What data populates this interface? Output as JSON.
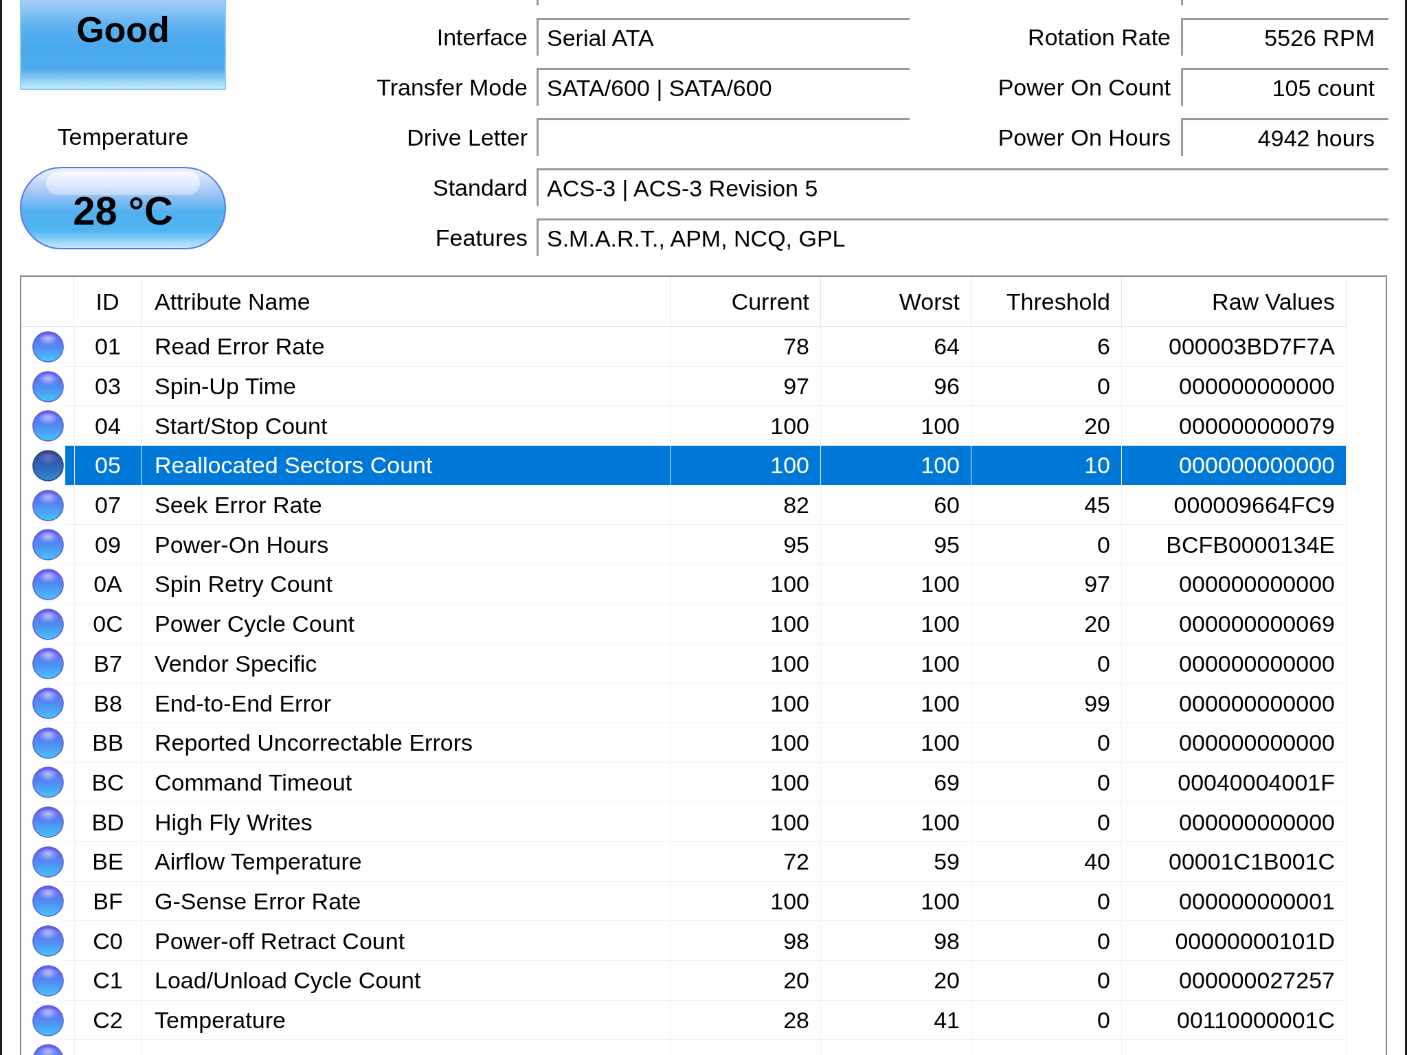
{
  "health": {
    "status": "Good"
  },
  "temperature": {
    "label": "Temperature",
    "value": "28 °C"
  },
  "drive_info": [
    {
      "kind": "paired",
      "label": "Interface",
      "value": "Serial ATA",
      "side_label": "Rotation Rate",
      "side_value": "5526 RPM"
    },
    {
      "kind": "paired",
      "label": "Transfer Mode",
      "value": "SATA/600 | SATA/600",
      "side_label": "Power On Count",
      "side_value": "105 count"
    },
    {
      "kind": "paired",
      "label": "Drive Letter",
      "side_label": "Power On Hours",
      "side_value": "4942 hours"
    },
    {
      "kind": "wide",
      "label": "Standard",
      "value": "ACS-3 | ACS-3 Revision 5"
    },
    {
      "kind": "wide",
      "label": "Features",
      "value": "S.M.A.R.T., APM, NCQ, GPL"
    }
  ],
  "smart_table": {
    "columns": [
      "ID",
      "Attribute Name",
      "Current",
      "Worst",
      "Threshold",
      "Raw Values"
    ],
    "rows": [
      {
        "id": "01",
        "name": "Read Error Rate",
        "current": "78",
        "worst": "64",
        "threshold": "6",
        "raw": "000003BD7F7A",
        "selected": false
      },
      {
        "id": "03",
        "name": "Spin-Up Time",
        "current": "97",
        "worst": "96",
        "threshold": "0",
        "raw": "000000000000",
        "selected": false
      },
      {
        "id": "04",
        "name": "Start/Stop Count",
        "current": "100",
        "worst": "100",
        "threshold": "20",
        "raw": "000000000079",
        "selected": false
      },
      {
        "id": "05",
        "name": "Reallocated Sectors Count",
        "current": "100",
        "worst": "100",
        "threshold": "10",
        "raw": "000000000000",
        "selected": true
      },
      {
        "id": "07",
        "name": "Seek Error Rate",
        "current": "82",
        "worst": "60",
        "threshold": "45",
        "raw": "000009664FC9",
        "selected": false
      },
      {
        "id": "09",
        "name": "Power-On Hours",
        "current": "95",
        "worst": "95",
        "threshold": "0",
        "raw": "BCFB0000134E",
        "selected": false
      },
      {
        "id": "0A",
        "name": "Spin Retry Count",
        "current": "100",
        "worst": "100",
        "threshold": "97",
        "raw": "000000000000",
        "selected": false
      },
      {
        "id": "0C",
        "name": "Power Cycle Count",
        "current": "100",
        "worst": "100",
        "threshold": "20",
        "raw": "000000000069",
        "selected": false
      },
      {
        "id": "B7",
        "name": "Vendor Specific",
        "current": "100",
        "worst": "100",
        "threshold": "0",
        "raw": "000000000000",
        "selected": false
      },
      {
        "id": "B8",
        "name": "End-to-End Error",
        "current": "100",
        "worst": "100",
        "threshold": "99",
        "raw": "000000000000",
        "selected": false
      },
      {
        "id": "BB",
        "name": "Reported Uncorrectable Errors",
        "current": "100",
        "worst": "100",
        "threshold": "0",
        "raw": "000000000000",
        "selected": false
      },
      {
        "id": "BC",
        "name": "Command Timeout",
        "current": "100",
        "worst": "69",
        "threshold": "0",
        "raw": "00040004001F",
        "selected": false
      },
      {
        "id": "BD",
        "name": "High Fly Writes",
        "current": "100",
        "worst": "100",
        "threshold": "0",
        "raw": "000000000000",
        "selected": false
      },
      {
        "id": "BE",
        "name": "Airflow Temperature",
        "current": "72",
        "worst": "59",
        "threshold": "40",
        "raw": "00001C1B001C",
        "selected": false
      },
      {
        "id": "BF",
        "name": "G-Sense Error Rate",
        "current": "100",
        "worst": "100",
        "threshold": "0",
        "raw": "000000000001",
        "selected": false
      },
      {
        "id": "C0",
        "name": "Power-off Retract Count",
        "current": "98",
        "worst": "98",
        "threshold": "0",
        "raw": "00000000101D",
        "selected": false
      },
      {
        "id": "C1",
        "name": "Load/Unload Cycle Count",
        "current": "20",
        "worst": "20",
        "threshold": "0",
        "raw": "000000027257",
        "selected": false
      },
      {
        "id": "C2",
        "name": "Temperature",
        "current": "28",
        "worst": "41",
        "threshold": "0",
        "raw": "00110000001C",
        "selected": false
      },
      {
        "selected": false
      }
    ]
  }
}
